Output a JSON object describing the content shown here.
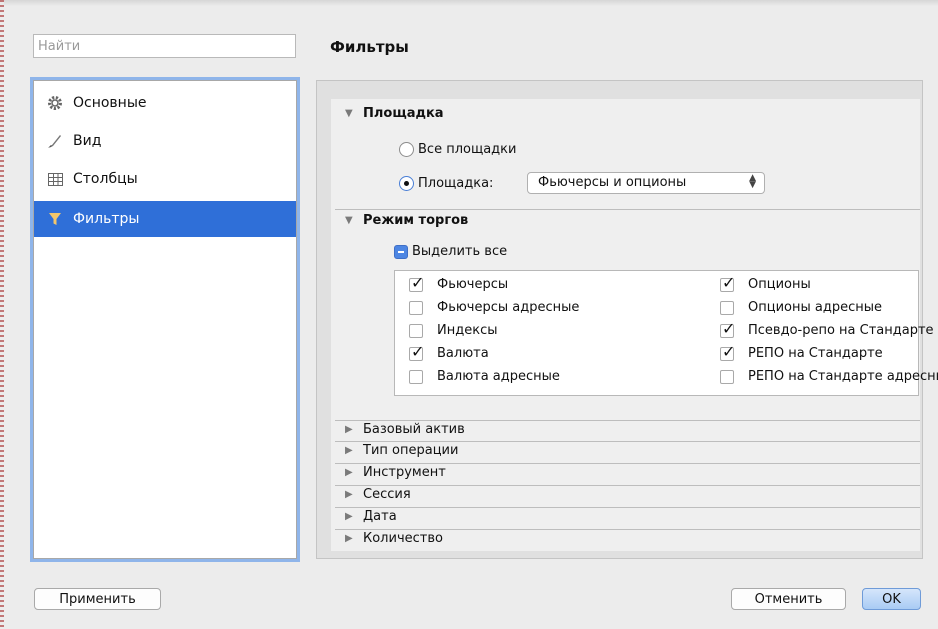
{
  "search": {
    "placeholder": "Найти"
  },
  "page_title": "Фильтры",
  "sidebar": {
    "items": [
      {
        "label": "Основные",
        "icon": "gear-icon",
        "selected": false
      },
      {
        "label": "Вид",
        "icon": "brush-icon",
        "selected": false
      },
      {
        "label": "Столбцы",
        "icon": "table-icon",
        "selected": false
      },
      {
        "label": "Фильтры",
        "icon": "funnel-icon",
        "selected": true
      }
    ]
  },
  "sections": {
    "venue": {
      "title": "Площадка",
      "all_label": "Все площадки",
      "specific_label": "Площадка:",
      "selected_option": "Фьючерсы и опционы"
    },
    "mode": {
      "title": "Режим торгов",
      "select_all": "Выделить все",
      "left": [
        {
          "label": "Фьючерсы",
          "checked": true
        },
        {
          "label": "Фьючерсы адресные",
          "checked": false
        },
        {
          "label": "Индексы",
          "checked": false
        },
        {
          "label": "Валюта",
          "checked": true
        },
        {
          "label": "Валюта адресные",
          "checked": false
        }
      ],
      "right": [
        {
          "label": "Опционы",
          "checked": true
        },
        {
          "label": "Опционы адресные",
          "checked": false
        },
        {
          "label": "Псевдо-репо на Стандарте",
          "checked": true
        },
        {
          "label": "РЕПО на Стандарте",
          "checked": true
        },
        {
          "label": "РЕПО на Стандарте адресные",
          "checked": false
        }
      ]
    },
    "collapsed": [
      "Базовый актив",
      "Тип операции",
      "Инструмент",
      "Сессия",
      "Дата",
      "Количество"
    ]
  },
  "buttons": {
    "apply": "Применить",
    "cancel": "Отменить",
    "ok": "OK"
  },
  "colors": {
    "selection": "#2f6fd8",
    "focus_ring": "#8fb5ea"
  }
}
